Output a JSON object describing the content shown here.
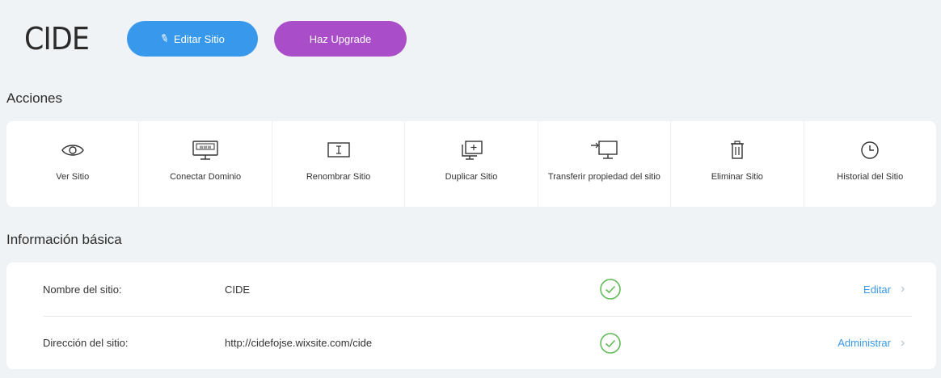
{
  "header": {
    "site_name": "CIDE",
    "edit_button_label": "Editar Sitio",
    "upgrade_button_label": "Haz Upgrade",
    "edit_color": "#3899ec",
    "upgrade_color": "#aa4dc8"
  },
  "actions": {
    "title": "Acciones",
    "items": [
      {
        "label": "Ver Sitio",
        "icon": "eye-icon"
      },
      {
        "label": "Conectar Dominio",
        "icon": "www-monitor-icon"
      },
      {
        "label": "Renombrar Sitio",
        "icon": "rename-icon"
      },
      {
        "label": "Duplicar Sitio",
        "icon": "duplicate-icon"
      },
      {
        "label": "Transferir propiedad del sitio",
        "icon": "transfer-icon"
      },
      {
        "label": "Eliminar Sitio",
        "icon": "trash-icon"
      },
      {
        "label": "Historial del Sitio",
        "icon": "clock-icon"
      }
    ]
  },
  "info": {
    "title": "Información básica",
    "rows": [
      {
        "label": "Nombre del sitio:",
        "value": "CIDE",
        "action": "Editar"
      },
      {
        "label": "Dirección del sitio:",
        "value": "http://cidefojse.wixsite.com/cide",
        "action": "Administrar"
      }
    ]
  }
}
